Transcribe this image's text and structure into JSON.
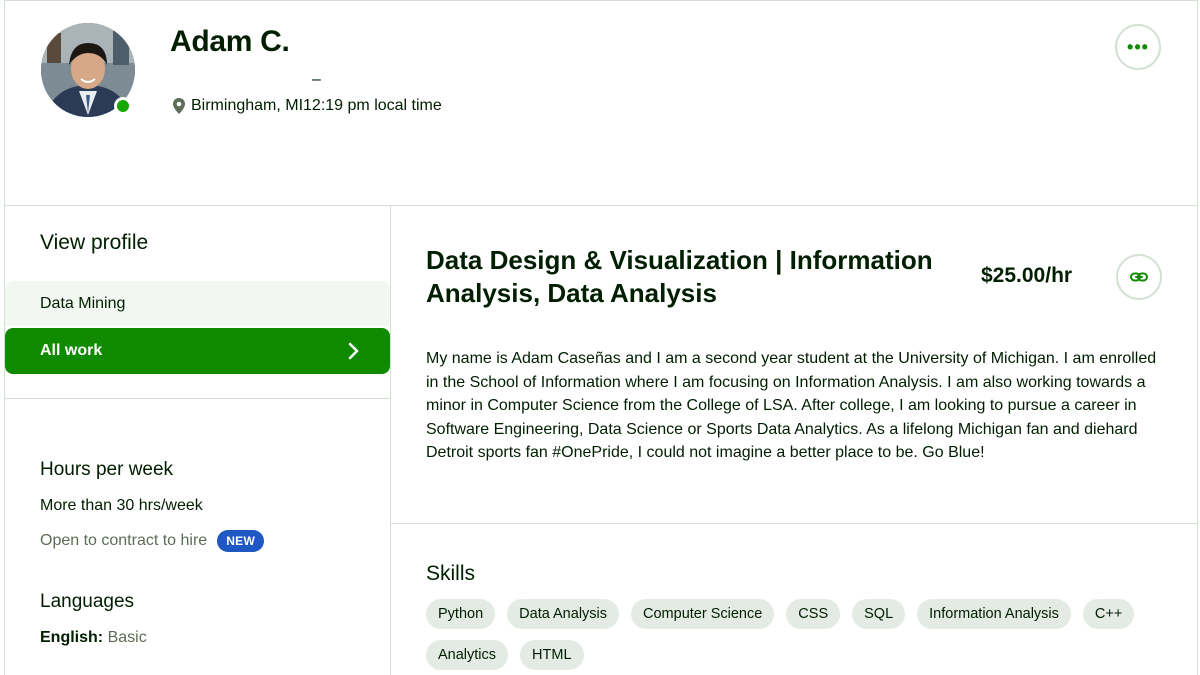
{
  "profile": {
    "name": "Adam C.",
    "dash": "–",
    "location": "Birmingham, MI",
    "local_time": "12:19 pm local time",
    "more_label": "•••"
  },
  "sidebar": {
    "view_profile": "View profile",
    "specialization": "Data Mining",
    "all_work": "All work",
    "hours_title": "Hours per week",
    "hours_value": "More than 30 hrs/week",
    "contract_text": "Open to contract to hire",
    "new_badge": "NEW",
    "languages_title": "Languages",
    "language_name": "English:",
    "language_level": "Basic"
  },
  "main": {
    "title": "Data Design & Visualization | Information Analysis, Data Analysis",
    "rate": "$25.00/hr",
    "overview": "My name is Adam Caseñas and I am a second year student at the University of Michigan. I am enrolled in the School of Information where I am focusing on Information Analysis. I am also working towards a minor in Computer Science from the College of LSA. After college, I am looking to pursue a career in Software Engineering, Data Science or Sports Data Analytics. As a lifelong Michigan fan and diehard Detroit sports fan #OnePride, I could not imagine a better place to be. Go Blue!",
    "skills_title": "Skills",
    "skills": [
      "Python",
      "Data Analysis",
      "Computer Science",
      "CSS",
      "SQL",
      "Information Analysis",
      "C++",
      "Analytics",
      "HTML"
    ]
  },
  "colors": {
    "brand_green": "#108a00",
    "online_green": "#14a800",
    "new_badge_blue": "#1f57c3",
    "skill_bg": "#e4ebe4"
  },
  "icons": {
    "location": "map-pin-icon",
    "more": "more-horizontal-icon",
    "link": "link-icon",
    "chevron": "chevron-right-icon"
  }
}
